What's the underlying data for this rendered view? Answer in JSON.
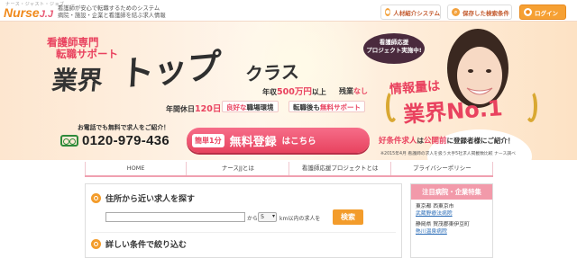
{
  "header": {
    "logo_kana": "ナース・ジャスト・ジョブ",
    "logo_main": "Nurse",
    "logo_accent": "J.J",
    "tagline_1": "看護師が安心で転職するためのシステム",
    "tagline_2": "病院・施設・企業と看護師を結ぶ求人情報",
    "buttons": {
      "agent": "人材紹介システム",
      "saved": "保存した検索条件",
      "login": "ログイン"
    }
  },
  "hero": {
    "sub_1": "看護師専門",
    "sub_2": "転職サポート",
    "big_1": "業界",
    "big_2": "トップ",
    "big_3": "クラス",
    "salary_pre": "年収",
    "salary_val": "500万円",
    "salary_post": "以上",
    "overtime_pre": "残業",
    "overtime_val": "なし",
    "holiday_pre": "年間休日",
    "holiday_val": "120日",
    "holiday_post": "以上",
    "chip_env_pk": "良好な",
    "chip_env": "職場環境",
    "chip_support_pre": "転職後も",
    "chip_support_pk": "無料サポート",
    "phone_note": "お電話でも無料で求人をご紹介！",
    "phone_number": "0120-979-436",
    "register_easy": "簡単1分",
    "register_main": "無料登録",
    "register_rest": "はこちら",
    "bubble_1": "看護師応援",
    "bubble_2": "プロジェクト実施中!",
    "info_1": "情報量は",
    "info_2": "業界No.1",
    "good_pk": "好条件求人",
    "good_mid": "は",
    "good_pk2": "公開前",
    "good_rest": "に登録者様にご紹介！",
    "footnote": "※2015年4月 看護師の求人を扱う大手5社求人掲載数比較 ナース調べ"
  },
  "nav": {
    "items": [
      "HOME",
      "ナースJJとは",
      "看護師応援プロジェクトとは",
      "プライバシーポリシー"
    ]
  },
  "search": {
    "near_title": "住所から近い求人を探す",
    "address_value": "",
    "from_label": "から",
    "km_value": "5",
    "km_label": "km以内の求人を",
    "search_button": "検索",
    "detail_title": "詳しい条件で絞り込む"
  },
  "side": {
    "title": "注目病院・企業特集",
    "items": [
      {
        "loc": "東京都 西東京市",
        "name": "武蔵野療法病院"
      },
      {
        "loc": "静岡県 賀茂郡東伊豆町",
        "name": "熱川温泉病院"
      }
    ]
  },
  "colors": {
    "accent_pink": "#e9425f",
    "accent_orange": "#f39c2b",
    "nav_border": "#f0a0b0"
  }
}
